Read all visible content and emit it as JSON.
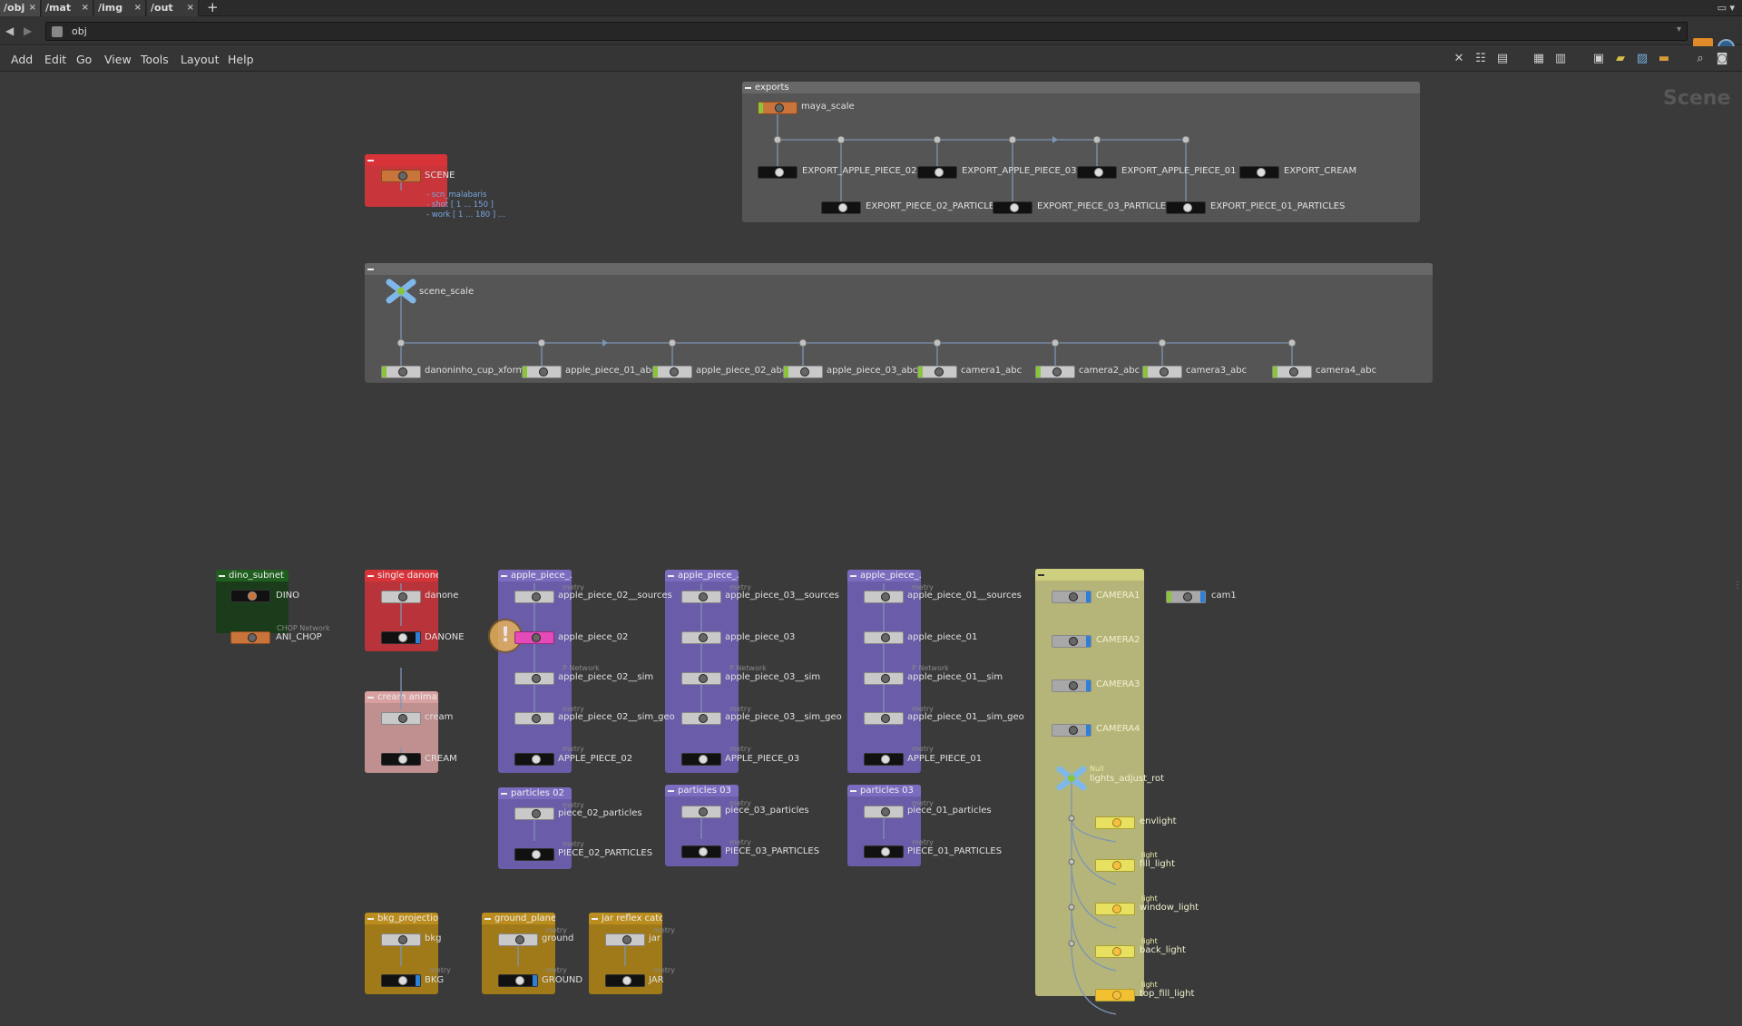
{
  "tabs": [
    {
      "label": "/obj",
      "active": true
    },
    {
      "label": "/mat"
    },
    {
      "label": "/img"
    },
    {
      "label": "/out"
    }
  ],
  "tab_add": "+",
  "tab_close": "×",
  "path": {
    "value": "obj"
  },
  "menus": [
    "Add",
    "Edit",
    "Go",
    "View",
    "Tools",
    "Layout",
    "Help"
  ],
  "canvas_title": "Scene",
  "boxes": {
    "exports": "exports",
    "scene": "",
    "scale": "",
    "dino": "dino_subnet",
    "single_danone": "single danone",
    "cream": "cream anima...",
    "ap02": "apple_piece_...",
    "ap03": "apple_piece_...",
    "ap01": "apple_piece_...",
    "p02": "particles 02",
    "p03a": "particles 03",
    "p03b": "particles 03",
    "lights": "",
    "bkg": "bkg_projection",
    "ground": "ground_plane",
    "jar": "jar reflex catc..."
  },
  "nodes": {
    "maya_scale": "maya_scale",
    "export_ap02": "EXPORT_APPLE_PIECE_02",
    "export_ap03": "EXPORT_APPLE_PIECE_03",
    "export_ap01": "EXPORT_APPLE_PIECE_01",
    "export_cream": "EXPORT_CREAM",
    "export_p02": "EXPORT_PIECE_02_PARTICLES",
    "export_p03": "EXPORT_PIECE_03_PARTICLES",
    "export_p01": "EXPORT_PIECE_01_PARTICLES",
    "scene": "SCENE",
    "scene_note1": "- scn_malabaris",
    "scene_note2": "- shot [ 1 ... 150 ]",
    "scene_note3": "- work [ 1 ... 180 ] ...",
    "scene_scale": "scene_scale",
    "danoninho": "danoninho_cup_xform",
    "ap01_abc": "apple_piece_01_abc",
    "ap02_abc": "apple_piece_02_abc",
    "ap03_abc": "apple_piece_03_abc",
    "camera1_abc": "camera1_abc",
    "camera2_abc": "camera2_abc",
    "camera3_abc": "camera3_abc",
    "camera4_abc": "camera4_abc",
    "dino": "DINO",
    "ani_chop": "ANI_CHOP",
    "chop_network": "CHOP Network",
    "danone": "danone",
    "danone_out": "DANONE",
    "cream": "cream",
    "cream_out": "CREAM",
    "ap02_sources": "apple_piece_02__sources",
    "ap02": "apple_piece_02",
    "ap02_sim": "apple_piece_02__sim",
    "ap02_sim_geo": "apple_piece_02__sim_geo",
    "ap02_out": "APPLE_PIECE_02",
    "ap03_sources": "apple_piece_03__sources",
    "ap03": "apple_piece_03",
    "ap03_sim": "apple_piece_03__sim",
    "ap03_sim_geo": "apple_piece_03__sim_geo",
    "ap03_out": "APPLE_PIECE_03",
    "ap01_sources": "apple_piece_01__sources",
    "ap01": "apple_piece_01",
    "ap01_sim": "apple_piece_01__sim",
    "ap01_sim_geo": "apple_piece_01__sim_geo",
    "ap01_out": "APPLE_PIECE_01",
    "p02": "piece_02_particles",
    "p02_out": "PIECE_02_PARTICLES",
    "p03": "piece_03_particles",
    "p03_out": "PIECE_03_PARTICLES",
    "p01": "piece_01_particles",
    "p01_out": "PIECE_01_PARTICLES",
    "camera1": "CAMERA1",
    "camera2": "CAMERA2",
    "camera3": "CAMERA3",
    "camera4": "CAMERA4",
    "cam1": "cam1",
    "null": "Null",
    "lights_adjust": "lights_adjust_rot",
    "envlight": "envlight",
    "fill_light": "fill_light",
    "window_light": "window_light",
    "back_light": "back_light",
    "top_fill_light": "top_fill_light",
    "light": "light",
    "bkg": "bkg",
    "bkg_out": "BKG",
    "ground": "ground",
    "ground_out": "GROUND",
    "jar": "jar",
    "jar_out": "JAR",
    "geometry": "Geometry",
    "metry": "metry",
    "net": "P Network"
  },
  "colors": {
    "exports": "#5a5a5a",
    "scene_box": "#d9333a",
    "scale_box": "#585858",
    "dino": "#1f5e1f",
    "danone": "#d9333a",
    "cream": "#d8a0a0",
    "apple": "#7c6cc0",
    "lights": "#bdbd76",
    "gold": "#bb8d1e"
  }
}
